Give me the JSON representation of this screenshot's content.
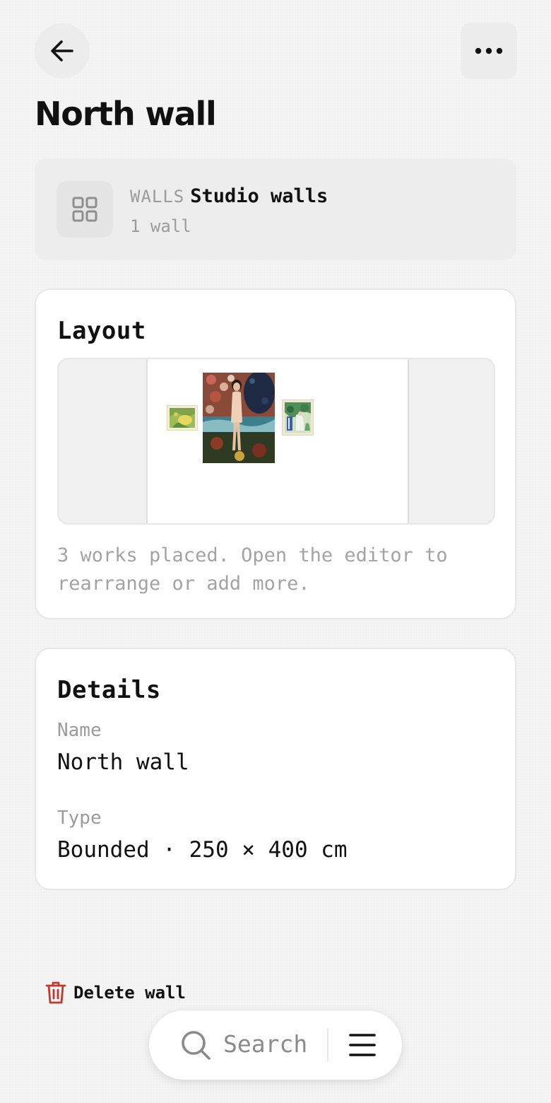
{
  "header": {
    "back_icon": "arrow-left-icon",
    "more_icon": "more-horizontal-icon",
    "title": "North wall"
  },
  "walls_group": {
    "icon": "grid-icon",
    "kicker": "WALLS",
    "name": "Studio walls",
    "count": "1 wall"
  },
  "layout": {
    "title": "Layout",
    "note": "3 works placed. Open the editor to rearrange or add more.",
    "artworks": [
      {
        "name": "landscape-painting"
      },
      {
        "name": "figure-painting"
      },
      {
        "name": "garden-painting"
      }
    ]
  },
  "details": {
    "title": "Details",
    "name_label": "Name",
    "name_value": "North wall",
    "type_label": "Type",
    "type_value": "Bounded · 250 × 400 cm"
  },
  "actions": {
    "delete_icon": "trash-icon",
    "delete_label": "Delete wall"
  },
  "bottom_bar": {
    "search_icon": "search-icon",
    "search_label": "Search",
    "menu_icon": "menu-icon"
  },
  "colors": {
    "delete_accent": "#c0392b",
    "card_bg": "#ffffff",
    "muted_text": "#9b9b9b"
  }
}
